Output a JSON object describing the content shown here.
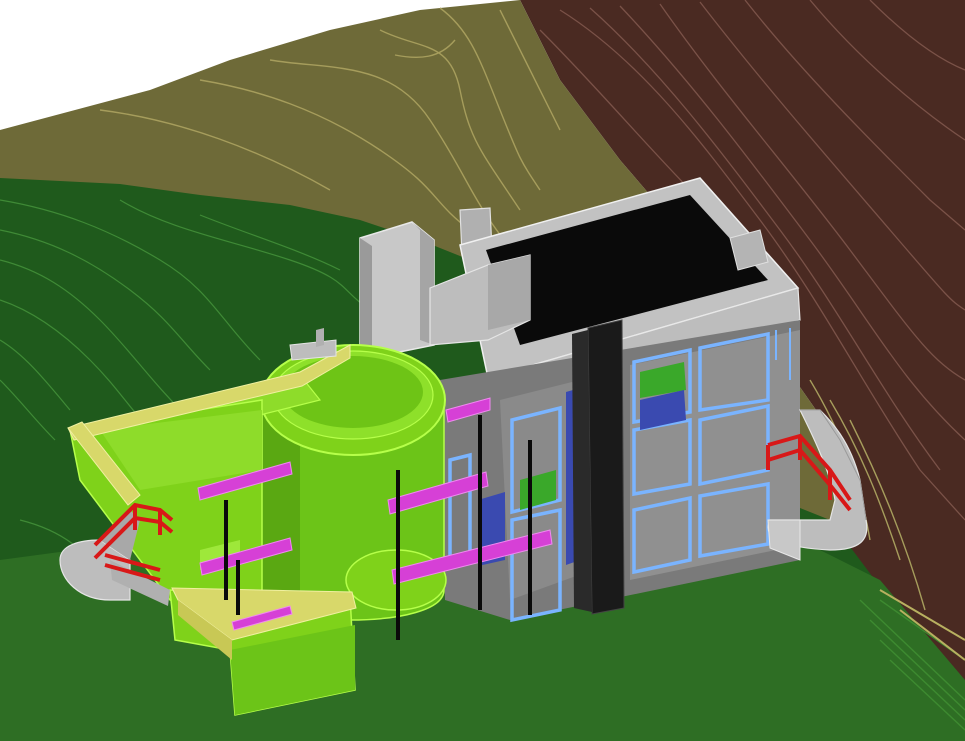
{
  "viewport": {
    "background": "#ffffff",
    "render_style": "3d-shaded-cad-model"
  },
  "colors": {
    "terrain_olive": "#6e6a38",
    "terrain_olive_contour": "#a69d5c",
    "terrain_brown": "#4a2a22",
    "terrain_brown_contour": "#7a5248",
    "terrain_green": "#1f5a1c",
    "terrain_green_contour": "#3f8a36",
    "lawn": "#2e6e24",
    "wall_lime": "#7fd21a",
    "wall_lime_edge": "#b6ff4a",
    "parapet_yellow": "#d8d86a",
    "concrete_gray": "#b8b8b8",
    "concrete_dark": "#8a8a8a",
    "roof_black": "#0a0a0a",
    "window_blue": "#7ab4ff",
    "glass_dark": "#3a4ab0",
    "beam_magenta": "#d640d6",
    "railing_red": "#d81818",
    "column_black": "#111111"
  },
  "icons": {
    "scene": "house-3d-model-icon"
  }
}
